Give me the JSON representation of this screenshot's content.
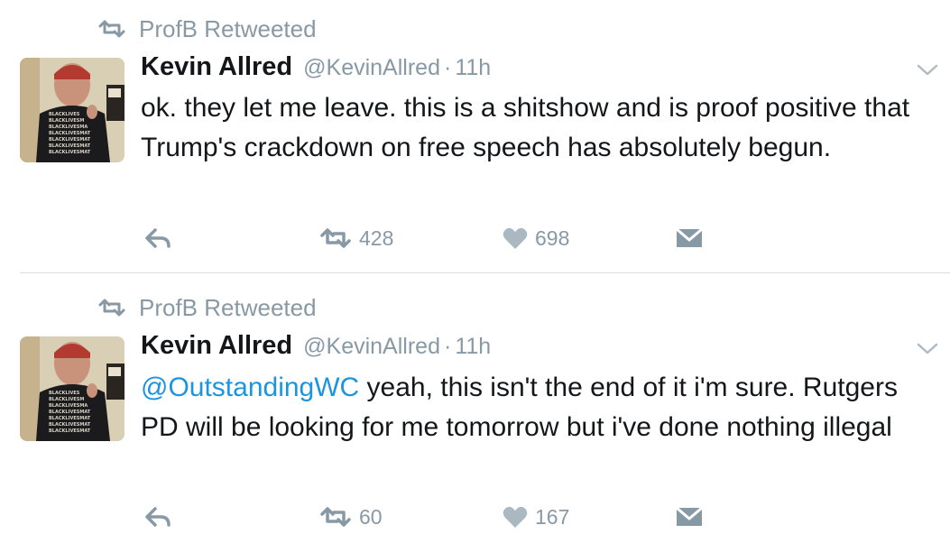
{
  "tweets": [
    {
      "retweeted_by": "ProfB Retweeted",
      "name": "Kevin Allred",
      "handle": "@KevinAllred",
      "dot": "·",
      "time": "11h",
      "mention": "",
      "text": "ok. they let me leave. this is a shitshow and is proof positive that Trump's crackdown on free speech has absolutely begun.",
      "retweets": "428",
      "likes": "698"
    },
    {
      "retweeted_by": "ProfB Retweeted",
      "name": "Kevin Allred",
      "handle": "@KevinAllred",
      "dot": "·",
      "time": "11h",
      "mention": "@OutstandingWC",
      "text": " yeah, this isn't the end of it i'm sure. Rutgers PD will be looking for me tomorrow but i've done nothing illegal",
      "retweets": "60",
      "likes": "167"
    }
  ],
  "icons": {
    "retweet": "retweet-icon",
    "reply": "reply-icon",
    "like": "heart-icon",
    "dm": "envelope-icon",
    "menu": "chevron-down-icon"
  },
  "colors": {
    "muted": "#8899a6",
    "link": "#1b95e0",
    "text": "#14171a"
  }
}
